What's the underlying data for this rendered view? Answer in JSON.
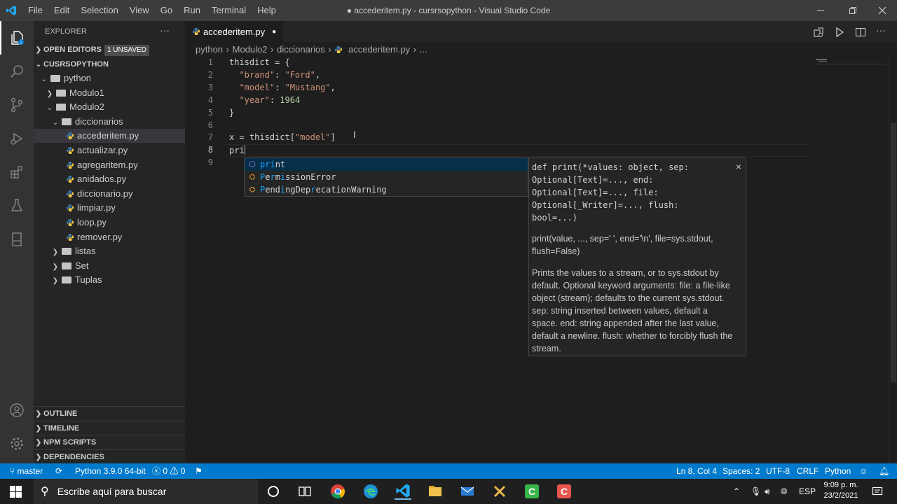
{
  "window": {
    "title": "● accederitem.py - cursrsopython - Visual Studio Code",
    "menu": [
      "File",
      "Edit",
      "Selection",
      "View",
      "Go",
      "Run",
      "Terminal",
      "Help"
    ]
  },
  "sidebar": {
    "title": "EXPLORER",
    "open_editors": {
      "label": "OPEN EDITORS",
      "badge": "1 UNSAVED"
    },
    "workspace": "CUSRSOPYTHON",
    "tree": [
      {
        "label": "python",
        "kind": "folder",
        "depth": 1,
        "expanded": true
      },
      {
        "label": "Modulo1",
        "kind": "folder",
        "depth": 2,
        "expanded": false
      },
      {
        "label": "Modulo2",
        "kind": "folder",
        "depth": 2,
        "expanded": true
      },
      {
        "label": "diccionarios",
        "kind": "folder",
        "depth": 3,
        "expanded": true
      },
      {
        "label": "accederitem.py",
        "kind": "py",
        "depth": 4,
        "selected": true
      },
      {
        "label": "actualizar.py",
        "kind": "py",
        "depth": 4
      },
      {
        "label": "agregaritem.py",
        "kind": "py",
        "depth": 4
      },
      {
        "label": "anidados.py",
        "kind": "py",
        "depth": 4
      },
      {
        "label": "diccionario.py",
        "kind": "py",
        "depth": 4
      },
      {
        "label": "limpiar.py",
        "kind": "py",
        "depth": 4
      },
      {
        "label": "loop.py",
        "kind": "py",
        "depth": 4
      },
      {
        "label": "remover.py",
        "kind": "py",
        "depth": 4
      },
      {
        "label": "listas",
        "kind": "folder",
        "depth": 3,
        "expanded": false
      },
      {
        "label": "Set",
        "kind": "folder",
        "depth": 3,
        "expanded": false
      },
      {
        "label": "Tuplas",
        "kind": "folder",
        "depth": 3,
        "expanded": false
      }
    ],
    "bottom_sections": [
      "OUTLINE",
      "TIMELINE",
      "NPM SCRIPTS",
      "DEPENDENCIES"
    ]
  },
  "editor": {
    "tab_label": "accederitem.py",
    "breadcrumb": [
      "python",
      "Modulo2",
      "diccionarios",
      "accederitem.py",
      "..."
    ],
    "line_numbers": [
      "1",
      "2",
      "3",
      "4",
      "5",
      "6",
      "7",
      "8",
      "9"
    ],
    "code": {
      "l1": "thisdict = {",
      "l2_key": "\"brand\"",
      "l2_val": "\"Ford\"",
      "l3_key": "\"model\"",
      "l3_val": "\"Mustang\"",
      "l4_key": "\"year\"",
      "l4_val": "1964",
      "l5": "}",
      "l7_a": "x = thisdict[",
      "l7_str": "\"model\"",
      "l7_b": "]",
      "l8": "pri"
    }
  },
  "suggest": {
    "items": [
      {
        "pre": "",
        "match": "pri",
        "post": "nt",
        "icon": "cube-icon"
      },
      {
        "pre": "",
        "match": "P",
        "mid1": "e",
        "match2": "r",
        "mid2": "m",
        "match3": "i",
        "post": "ssionError",
        "icon": "class-icon"
      },
      {
        "pre": "",
        "match": "P",
        "mid1": "end",
        "match2": "i",
        "mid2": "ngDep",
        "match3": "r",
        "post": "ecationWarning",
        "icon": "class-icon"
      }
    ],
    "doc_signature": "def print(*values: object, sep: Optional[Text]=..., end: Optional[Text]=..., file: Optional[_Writer]=..., flush: bool=...)",
    "doc_usage": "print(value, ..., sep=' ', end='\\n', file=sys.stdout, flush=False)",
    "doc_text": "Prints the values to a stream, or to sys.stdout by default. Optional keyword arguments: file: a file-like object (stream); defaults to the current sys.stdout. sep: string inserted between values, default a space. end: string appended after the last value, default a newline. flush: whether to forcibly flush the stream.",
    "close": "×"
  },
  "status": {
    "branch": "master",
    "interpreter": "Python 3.9.0 64-bit",
    "errors": "0",
    "warnings": "0",
    "position": "Ln 8, Col 4",
    "spaces": "Spaces: 2",
    "encoding": "UTF-8",
    "eol": "CRLF",
    "language": "Python"
  },
  "taskbar": {
    "search_placeholder": "Escribe aquí para buscar",
    "lang": "ESP",
    "time": "9:09 p. m.",
    "date": "23/2/2021"
  },
  "colors": {
    "accent": "#007acc",
    "activity": "#333333",
    "sidebar": "#252526",
    "editor": "#1e1e1e"
  }
}
